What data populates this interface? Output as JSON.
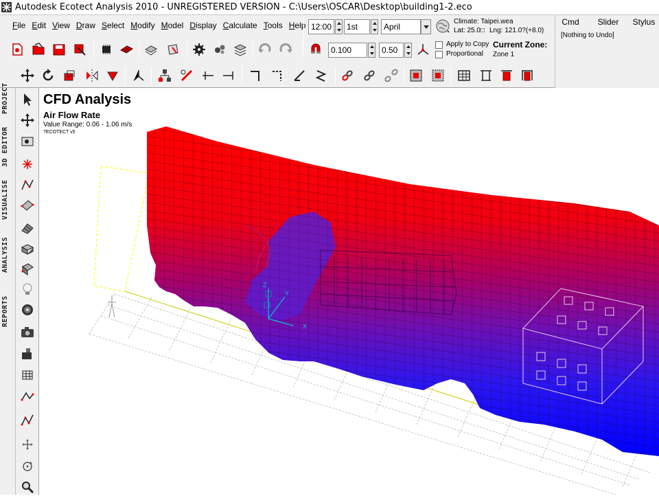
{
  "window": {
    "title": "Autodesk Ecotect Analysis 2010 - UNREGISTERED VERSION - C:\\Users\\OSCAR\\Desktop\\building1-2.eco"
  },
  "menu": [
    "File",
    "Edit",
    "View",
    "Draw",
    "Select",
    "Modify",
    "Model",
    "Display",
    "Calculate",
    "Tools",
    "Help"
  ],
  "time": {
    "hour": "12:00",
    "day": "1st",
    "month": "April"
  },
  "climate": {
    "label": "Climate: Taipei.wea",
    "lat": "Lat: 25.0□",
    "lng": "Lng: 121.0?(+8.0)"
  },
  "snap": {
    "value1": "0.100",
    "value2": "0.50",
    "apply_to_copy": "Apply to Copy",
    "proportional": "Proportional"
  },
  "zone": {
    "label": "Current Zone:",
    "value": "Zone 1"
  },
  "panel": {
    "tabs": [
      "Cmd",
      "Slider",
      "Stylus"
    ],
    "undo": "[Nothing to Undo]"
  },
  "side_tabs": [
    "PROJECT",
    "3D EDITOR",
    "VISUALISE",
    "ANALYSIS",
    "REPORTS"
  ],
  "viewport": {
    "title": "CFD Analysis",
    "subtitle": "Air Flow Rate",
    "range": "Value Range: 0.06 - 1.06 m/s",
    "brand": "?ECOTECT v5",
    "axis_labels": {
      "x": "X",
      "y": "Y",
      "z": "Z"
    }
  },
  "colors": {
    "high": "#ff0000",
    "mid": "#8000a0",
    "low": "#0000ff",
    "chrome": "#f0f0f0",
    "grid": "#b0b0b0",
    "outline": "#ffff00"
  }
}
